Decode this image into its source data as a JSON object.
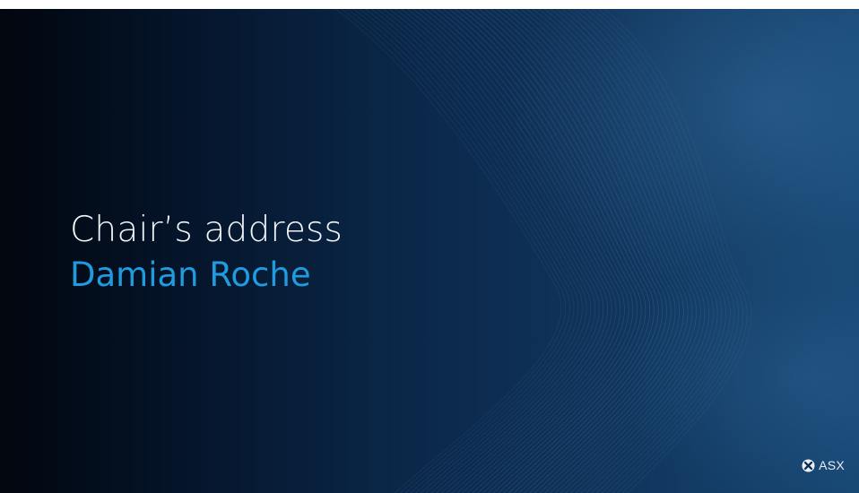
{
  "slide": {
    "title": "Chair’s address",
    "speaker": "Damian Roche"
  },
  "brand": {
    "logo_icon": "asx-logo-icon",
    "name": "ASX"
  },
  "colors": {
    "background_dark": "#02060e",
    "background_light": "#164672",
    "title_text": "#f2f5f8",
    "speaker_text": "#1f9be0",
    "wave_lines": "#5b8fbd"
  }
}
